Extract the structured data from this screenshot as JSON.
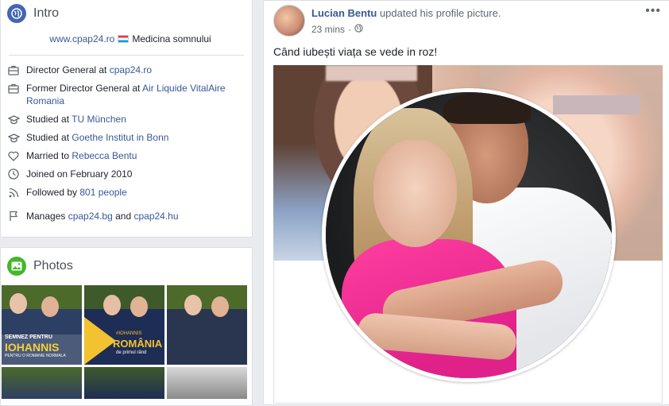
{
  "intro": {
    "title": "Intro",
    "website": "www.cpap24.ro",
    "website_note": "Medicina somnului",
    "items": [
      {
        "icon": "briefcase-icon",
        "prefix": "Director General at ",
        "link": "cpap24.ro"
      },
      {
        "icon": "briefcase-icon",
        "prefix": "Former Director General at ",
        "link": "Air Liquide VitalAire Romania"
      },
      {
        "icon": "graduation-cap-icon",
        "prefix": "Studied at ",
        "link": "TU München"
      },
      {
        "icon": "graduation-cap-icon",
        "prefix": "Studied at ",
        "link": "Goethe Institut in Bonn"
      },
      {
        "icon": "heart-icon",
        "prefix": "Married to ",
        "link": "Rebecca Bentu"
      },
      {
        "icon": "clock-icon",
        "prefix": "Joined on February 2010",
        "link": ""
      },
      {
        "icon": "rss-icon",
        "prefix": "Followed by ",
        "link": "801 people"
      },
      {
        "icon": "flag-icon",
        "prefix": "Manages ",
        "link": "cpap24.bg",
        "middle": " and ",
        "link2": "cpap24.hu"
      }
    ]
  },
  "photos": {
    "title": "Photos",
    "tiles": [
      {
        "caption1": "SEMNEZ PENTRU",
        "caption2": "IOHANNIS",
        "caption3": "PENTRU O ROMANIE NORMALA"
      },
      {
        "caption1": "#IOHANNIS",
        "caption2": "ROMÂNIA",
        "caption3": "de primul rând"
      },
      {
        "caption1": "",
        "caption2": "",
        "caption3": ""
      }
    ]
  },
  "post": {
    "author": "Lucian Bentu",
    "action": " updated his profile picture.",
    "time": "23 mins",
    "more": "•••",
    "text": "Când iubești viața se vede in roz!"
  },
  "colors": {
    "link": "#385898",
    "intro_icon": "#4267b2",
    "photos_icon": "#42b72a"
  }
}
